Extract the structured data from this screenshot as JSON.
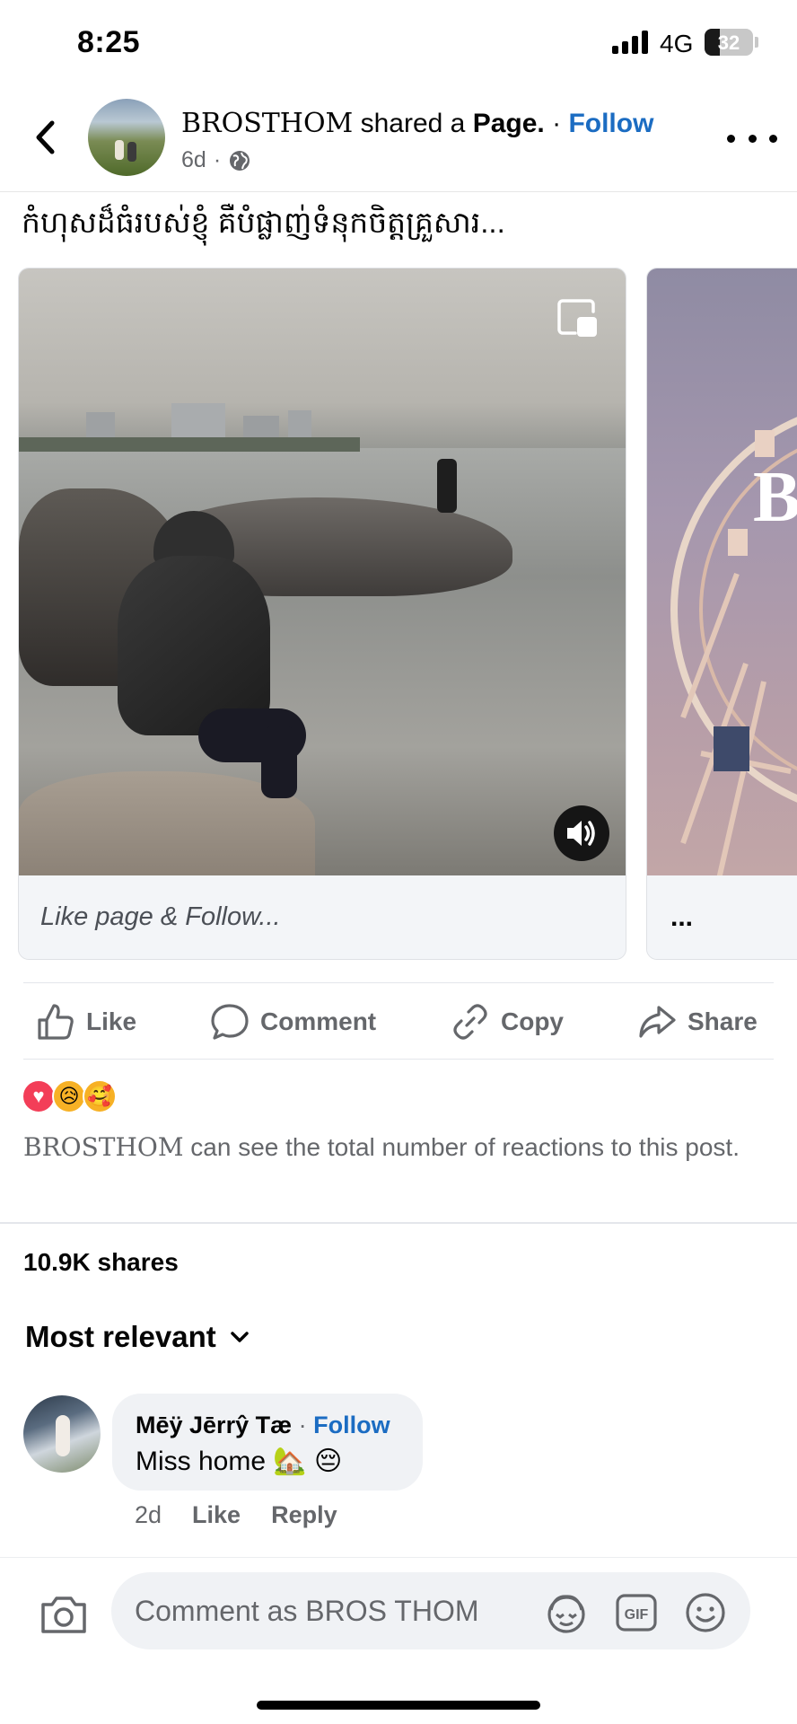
{
  "status_bar": {
    "time": "8:25",
    "network": "4G",
    "battery": "32",
    "battery_level": 0.32
  },
  "header": {
    "page_name": "BROSTHOM",
    "action_text": "shared a",
    "object_text": "Page.",
    "separator": "·",
    "follow_label": "Follow",
    "age": "6d",
    "dot": "·"
  },
  "post": {
    "caption": "កំហុសដ៏ធំរបស់ខ្ញុំ គឺបំផ្លាញ់ទំនុកចិត្តគ្រួសារ...",
    "cards": [
      {
        "footer_text": "Like page & Follow..."
      },
      {
        "footer_text": "..."
      }
    ]
  },
  "actions": {
    "like": "Like",
    "comment": "Comment",
    "copy": "Copy",
    "share": "Share"
  },
  "reactions": {
    "icons": [
      "love",
      "sad",
      "care"
    ],
    "emoji": [
      "♥",
      "😥",
      "🥰"
    ],
    "note_name": "BROSTHOM",
    "note_text": " can see the total number of reactions to this post."
  },
  "shares": "10.9K shares",
  "sort_label": "Most relevant",
  "comment": {
    "author": "Mēÿ Jērrŷ Tæ",
    "separator": "·",
    "follow_label": "Follow",
    "text": "Miss home 🏡 😔",
    "age": "2d",
    "like_label": "Like",
    "reply_label": "Reply"
  },
  "composer": {
    "placeholder": "Comment as BROS THOM"
  },
  "colors": {
    "link": "#1b6cc2",
    "muted": "#65676b",
    "love": "#f33e58",
    "haha": "#f7b125"
  }
}
